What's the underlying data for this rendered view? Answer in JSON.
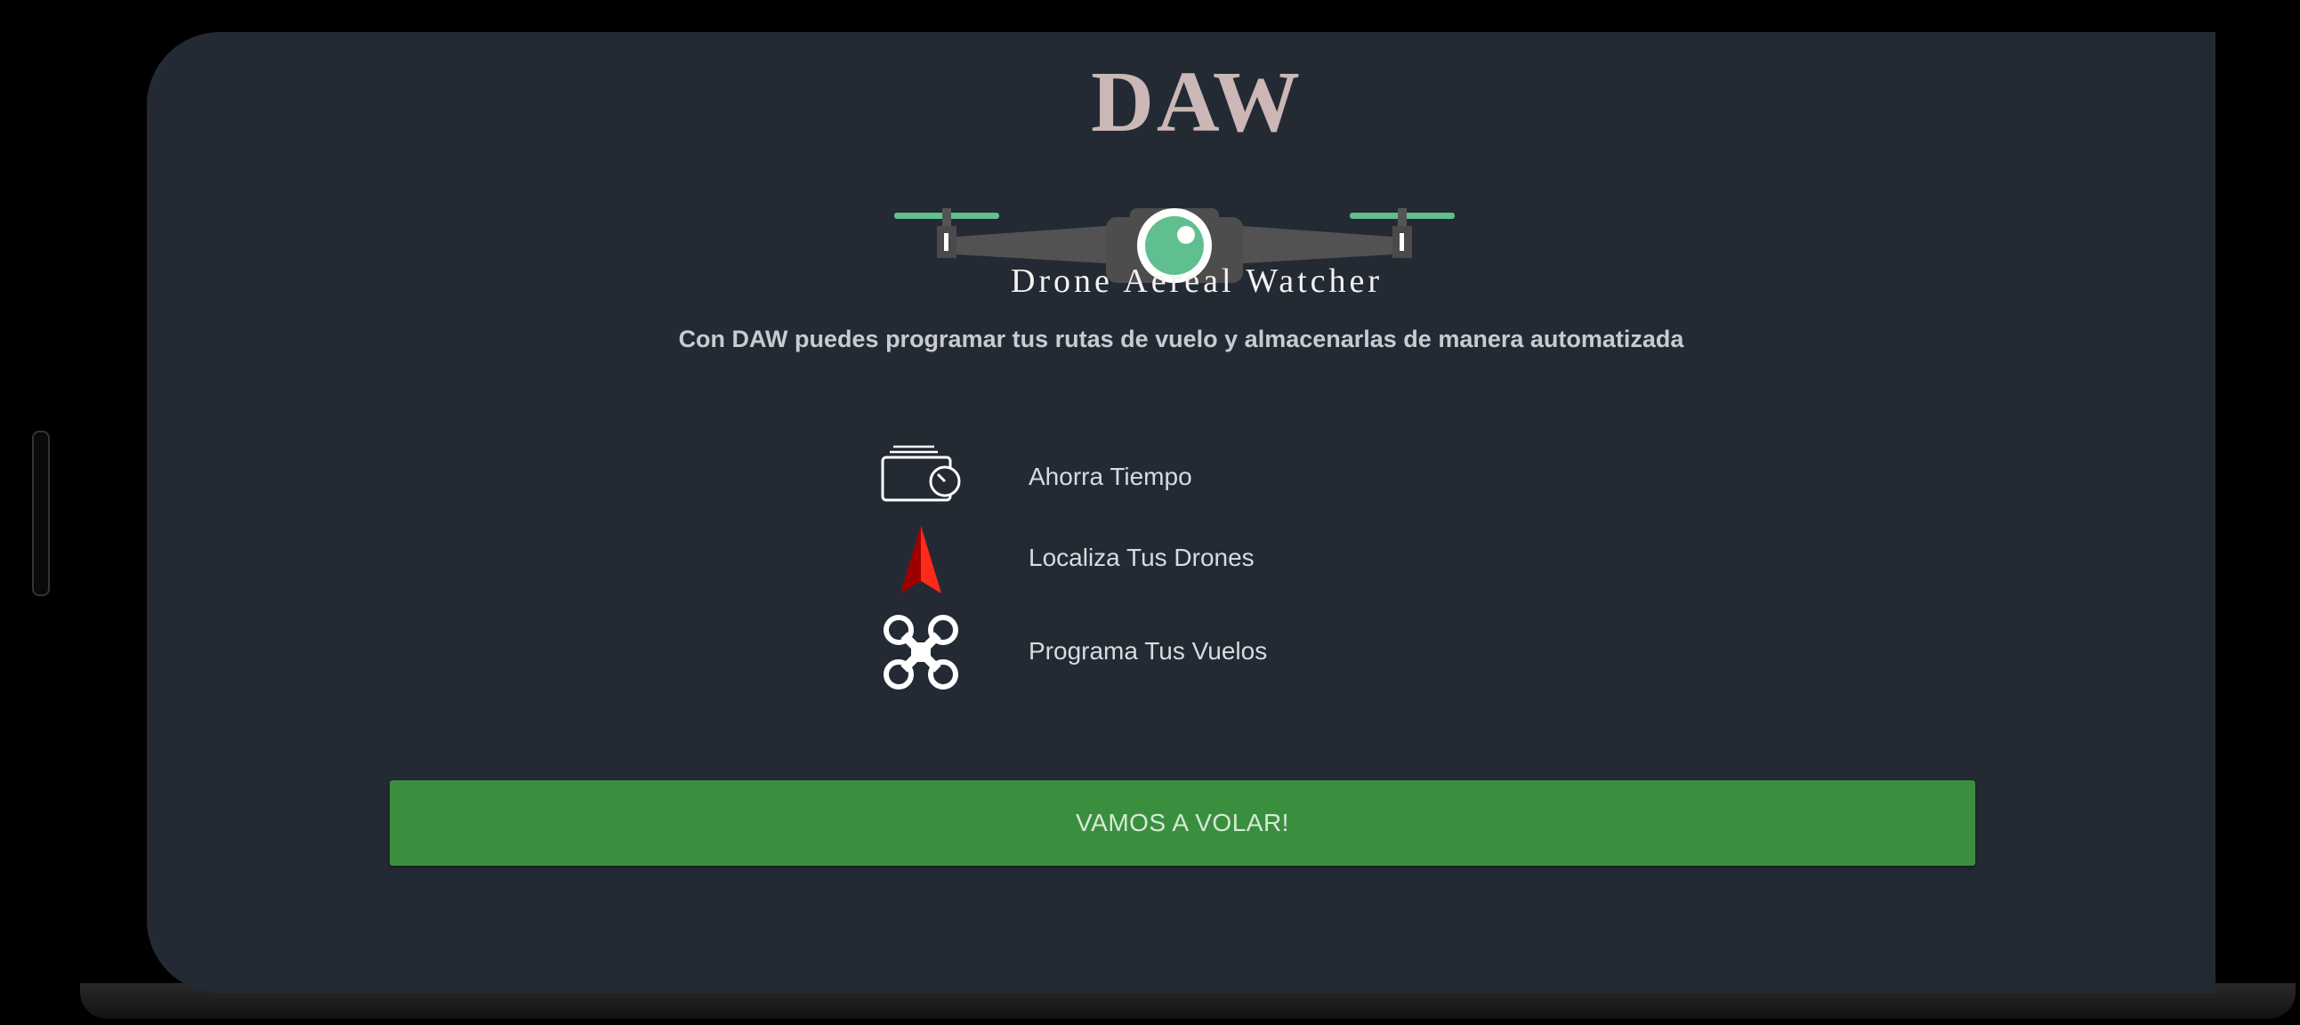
{
  "logo": {
    "title": "DAW",
    "subtitle": "Drone Aereal Watcher",
    "icon": "drone-eye-logo"
  },
  "tagline": "Con DAW puedes programar tus rutas de vuelo y almacenarlas de manera automatizada",
  "features": [
    {
      "icon": "wallet-clock-icon",
      "label": "Ahorra Tiempo"
    },
    {
      "icon": "red-arrow-locator-icon",
      "label": "Localiza Tus Drones"
    },
    {
      "icon": "quadcopter-icon",
      "label": "Programa Tus Vuelos"
    }
  ],
  "cta": {
    "label": "VAMOS A VOLAR!"
  },
  "colors": {
    "screen_background": "#232a33",
    "logo_title": "#cbb7b5",
    "accent_green": "#3a8f3e",
    "propeller_green": "#5fbf8f",
    "locator_red": "#d40000"
  }
}
